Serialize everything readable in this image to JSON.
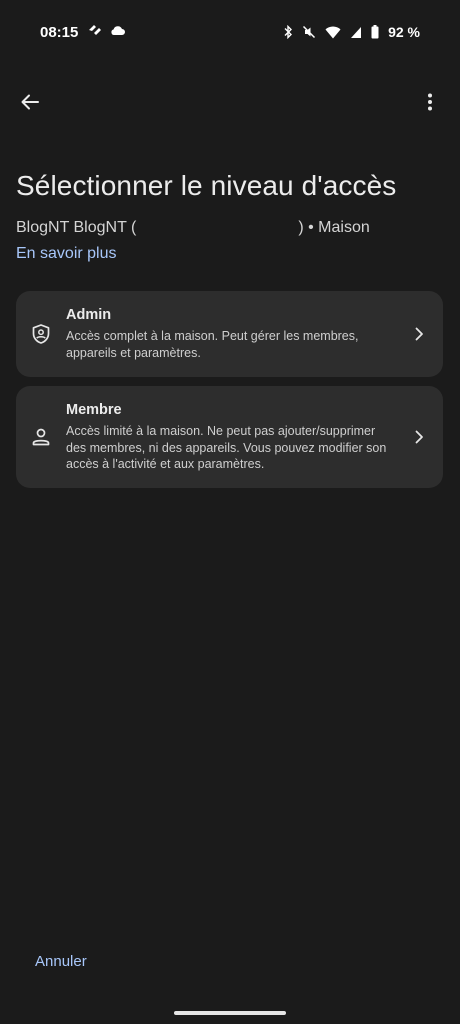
{
  "status_bar": {
    "time": "08:15",
    "battery_text": "92 %",
    "icons": [
      "glider-icon",
      "cloud-icon",
      "bluetooth-icon",
      "mute-icon",
      "wifi-icon",
      "signal-icon",
      "battery-icon"
    ]
  },
  "app_bar": {
    "back_icon": "arrow-back-icon",
    "menu_icon": "more-vert-icon"
  },
  "page": {
    "title": "Sélectionner le niveau d'accès",
    "subtitle_left": "BlogNT BlogNT (",
    "subtitle_right": ") • Maison",
    "learn_more": "En savoir plus"
  },
  "options": [
    {
      "title": "Admin",
      "description": "Accès complet à la maison. Peut gérer les membres, appareils et paramètres.",
      "icon": "shield-person-icon"
    },
    {
      "title": "Membre",
      "description": "Accès limité à la maison. Ne peut pas ajouter/supprimer des membres, ni des appareils. Vous pouvez modifier son accès à l'activité et aux paramètres.",
      "icon": "person-icon"
    }
  ],
  "footer": {
    "cancel": "Annuler"
  },
  "colors": {
    "background": "#1b1b1b",
    "card": "#2d2d2d",
    "accent": "#a8c7fa"
  }
}
